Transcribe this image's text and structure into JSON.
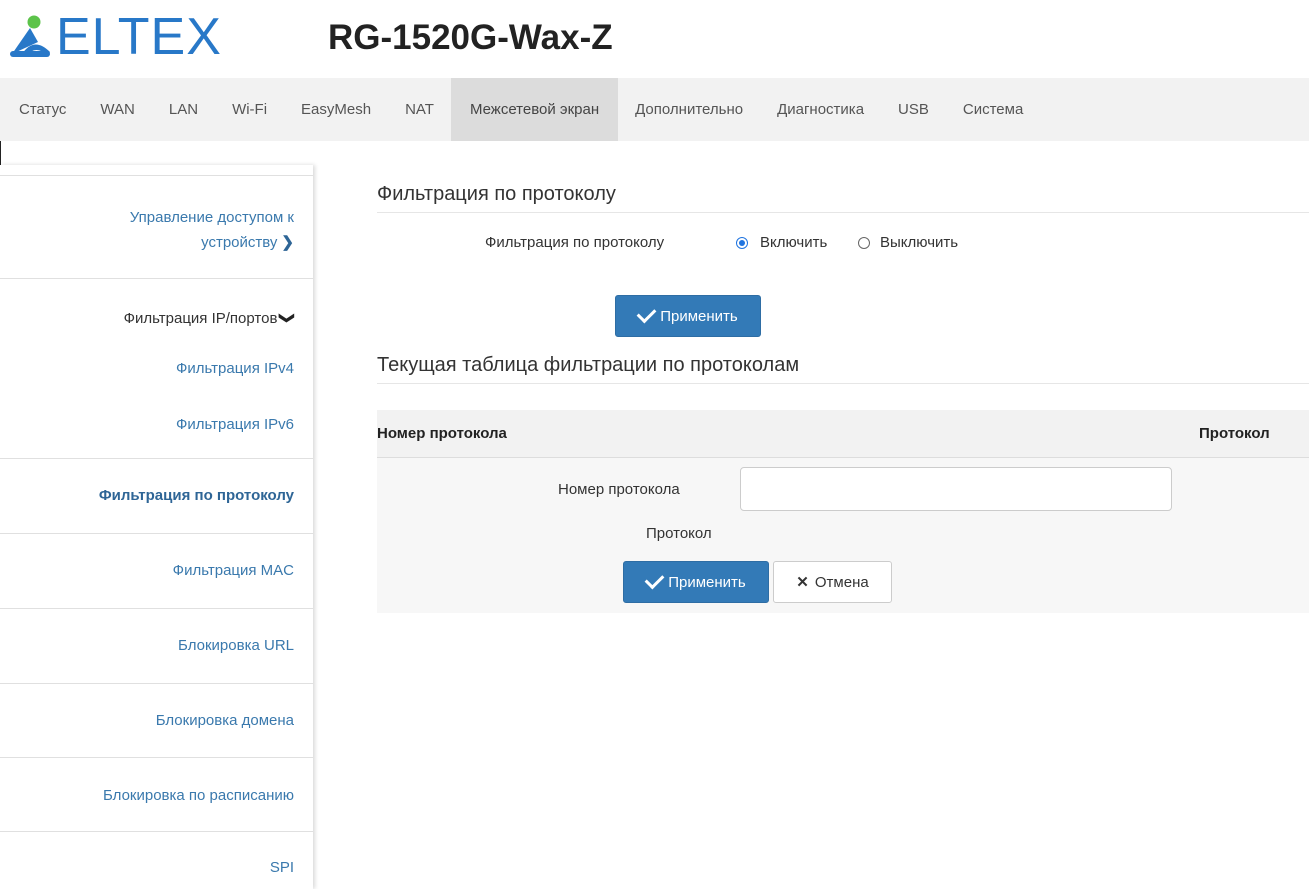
{
  "header": {
    "brand": "ELTEX",
    "model": "RG-1520G-Wax-Z"
  },
  "topnav": {
    "tabs": [
      {
        "label": "Статус"
      },
      {
        "label": "WAN"
      },
      {
        "label": "LAN"
      },
      {
        "label": "Wi-Fi"
      },
      {
        "label": "EasyMesh"
      },
      {
        "label": "NAT"
      },
      {
        "label": "Межсетевой экран",
        "active": true
      },
      {
        "label": "Дополнительно"
      },
      {
        "label": "Диагностика"
      },
      {
        "label": "USB"
      },
      {
        "label": "Система"
      }
    ]
  },
  "sidebar": {
    "access_line1": "Управление доступом к",
    "access_line2": "устройству",
    "ipport": "Фильтрация IP/портов",
    "ipv4": "Фильтрация IPv4",
    "ipv6": "Фильтрация IPv6",
    "protocol": "Фильтрация по протоколу",
    "mac": "Фильтрация MAC",
    "url": "Блокировка URL",
    "domain": "Блокировка домена",
    "schedule": "Блокировка по расписанию",
    "spi": "SPI"
  },
  "main": {
    "section1_title": "Фильтрация по протоколу",
    "filter_label": "Фильтрация по протоколу",
    "enable_label": "Включить",
    "disable_label": "Выключить",
    "filter_enabled": true,
    "apply_label": "Применить",
    "section2_title": "Текущая таблица фильтрации по протоколам",
    "table": {
      "columns": [
        "Номер протокола",
        "Протокол"
      ]
    },
    "form": {
      "number_label": "Номер протокола",
      "number_value": "",
      "protocol_label": "Протокол",
      "apply_label": "Применить",
      "cancel_label": "Отмена"
    }
  },
  "colors": {
    "brand": "#2878c8",
    "primary_button": "#337ab7",
    "link": "#3a79ad"
  }
}
